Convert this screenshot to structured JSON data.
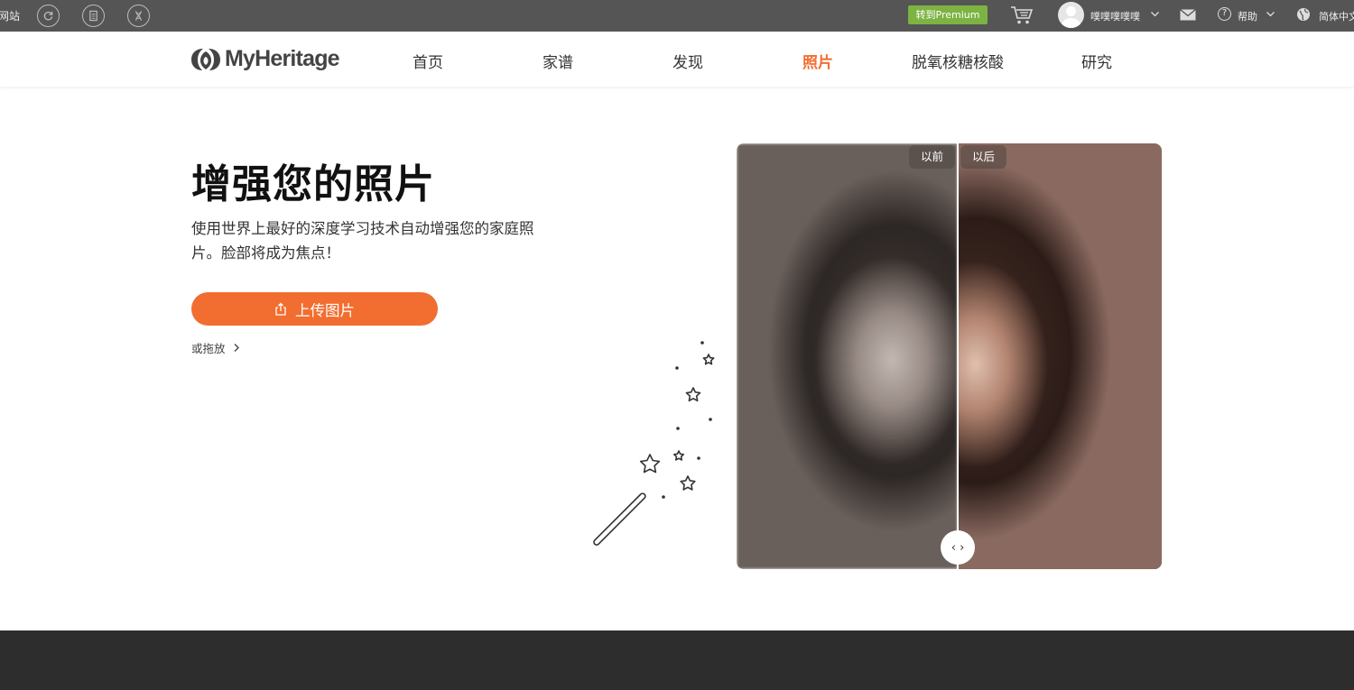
{
  "topbar": {
    "site_label": "网站",
    "premium_label": "转到Premium",
    "username": "噗噗噗噗噗",
    "help_label": "帮助",
    "help_glyph": "?",
    "language_label": "简体中文",
    "icons": [
      "refresh-icon",
      "document-icon",
      "dna-icon",
      "cart-icon",
      "mail-icon",
      "help-icon",
      "globe-icon"
    ]
  },
  "nav": {
    "logo_text": "MyHeritage",
    "items": [
      {
        "label": "首页"
      },
      {
        "label": "家谱"
      },
      {
        "label": "发现"
      },
      {
        "label": "照片"
      },
      {
        "label": "脱氧核糖核酸"
      },
      {
        "label": "研究"
      }
    ],
    "active_index": 3
  },
  "hero": {
    "title": "增强您的照片",
    "description": "使用世界上最好的深度学习技术自动增强您的家庭照片。脸部将成为焦点！",
    "upload_label": "上传图片",
    "drop_label": "或拖放"
  },
  "compare": {
    "before_label": "以前",
    "after_label": "以后",
    "handle_glyph": "‹ ›"
  },
  "colors": {
    "accent": "#f26d30",
    "premium": "#7cb342",
    "topbar": "#555555",
    "footer": "#2d2d2d"
  }
}
